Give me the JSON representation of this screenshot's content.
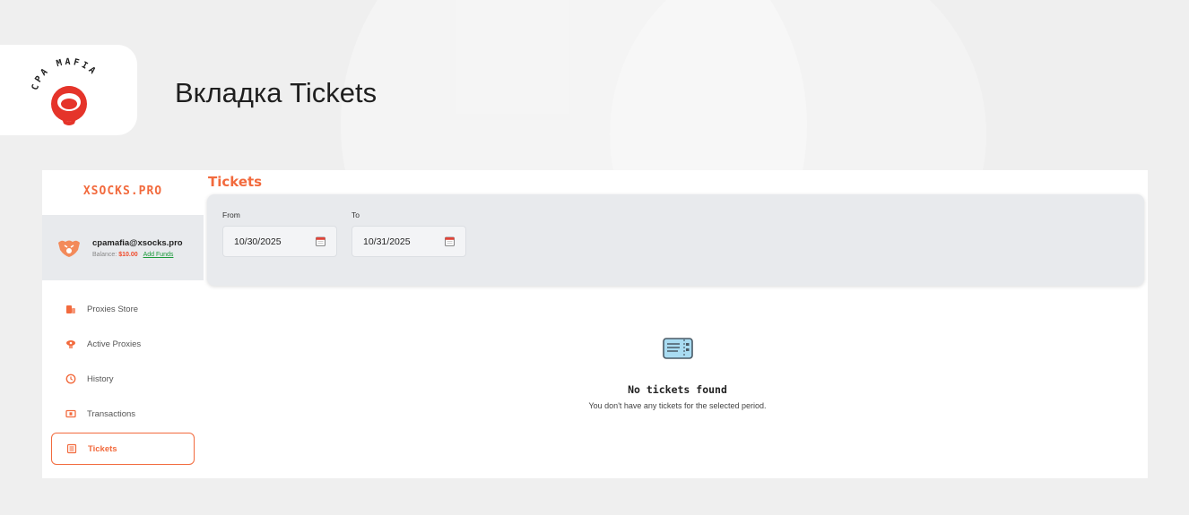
{
  "slide": {
    "title": "Вкладка Tickets"
  },
  "logo": {
    "text": "CPA MAFIA"
  },
  "app": {
    "brand": "XSOCKS.PRO",
    "user": {
      "email": "cpamafia@xsocks.pro",
      "balance_label": "Balance:",
      "balance_amount": "$10.00",
      "add_funds": "Add Funds"
    },
    "nav": [
      {
        "label": "Proxies Store",
        "icon": "store-icon"
      },
      {
        "label": "Active Proxies",
        "icon": "active-proxies-icon"
      },
      {
        "label": "History",
        "icon": "clock-icon"
      },
      {
        "label": "Transactions",
        "icon": "money-icon"
      },
      {
        "label": "Tickets",
        "icon": "tickets-icon",
        "active": true
      }
    ],
    "page_title": "Tickets",
    "filters": {
      "from_label": "From",
      "from_value": "10/30/2025",
      "to_label": "To",
      "to_value": "10/31/2025"
    },
    "empty_state": {
      "title": "No tickets found",
      "message": "You don't have any tickets for the selected period."
    },
    "colors": {
      "accent": "#f26a3d",
      "balance": "#f04a2a",
      "add_funds": "#1a9a3a",
      "panel": "#e8eaed"
    }
  }
}
